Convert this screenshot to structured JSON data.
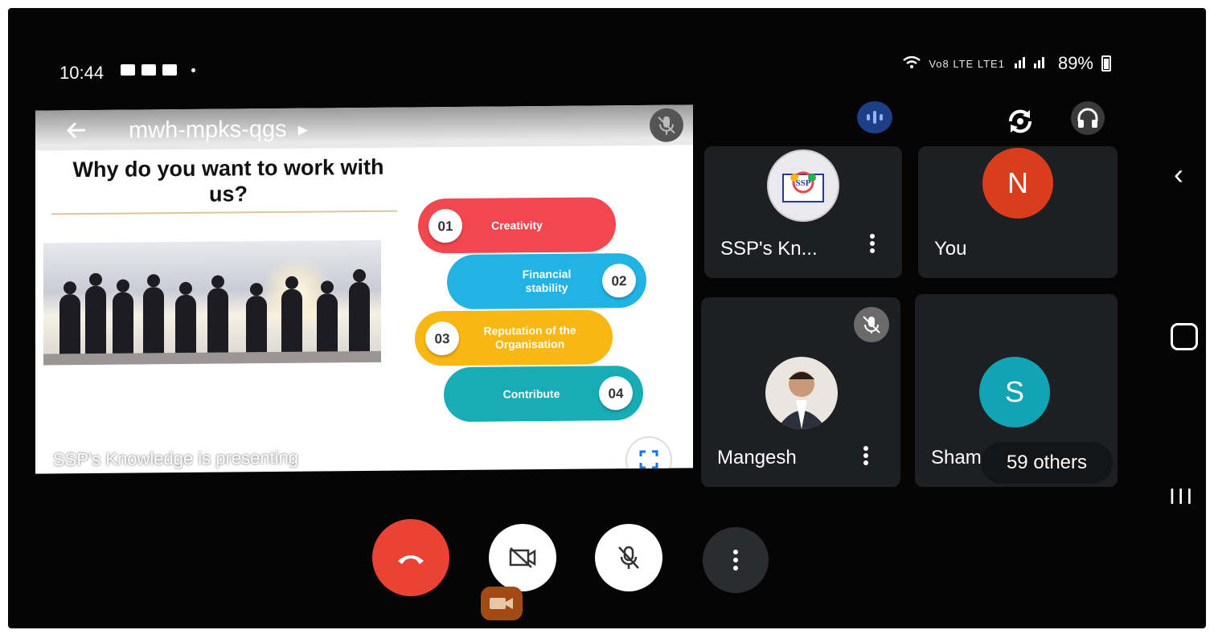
{
  "status_bar": {
    "time": "10:44",
    "left_icons": [
      "chat-icon",
      "image-icon",
      "video-icon"
    ],
    "network": "Vo8 LTE LTE1",
    "battery": "89%"
  },
  "meeting": {
    "code": "mwh-mpks-qgs",
    "presenter_text": "SSP's Knowledge is presenting"
  },
  "slide": {
    "title": "Why do you want to work with us?",
    "items": [
      {
        "number": "01",
        "label": "Creativity",
        "color": "#f2474f"
      },
      {
        "number": "02",
        "label": "Financial stability",
        "color": "#22b3e5"
      },
      {
        "number": "03",
        "label": "Reputation of the Organisation",
        "color": "#f8b712"
      },
      {
        "number": "04",
        "label": "Contribute",
        "color": "#18acb7"
      }
    ]
  },
  "participants": [
    {
      "name": "SSP's Kn...",
      "avatar": "logo"
    },
    {
      "name": "You",
      "avatar": "N",
      "color": "#d93d1c"
    },
    {
      "name": "Mangesh",
      "avatar": "photo",
      "muted": true
    },
    {
      "name": "Sham",
      "avatar": "S",
      "color": "#12a4b4"
    }
  ],
  "others_count": "59 others",
  "controls": {
    "end_call": "phone-hangup-icon",
    "camera": "camera-off-icon",
    "mic": "mic-off-icon",
    "more": "more-vert-icon"
  }
}
